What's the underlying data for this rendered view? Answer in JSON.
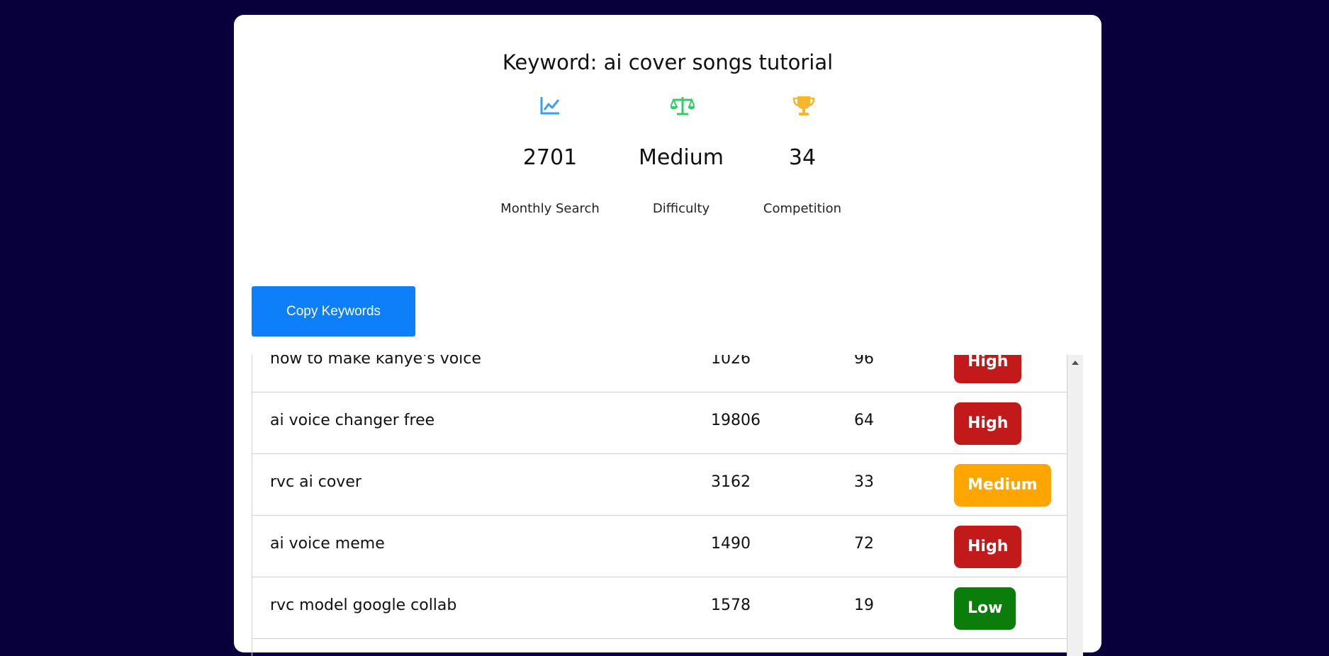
{
  "header": {
    "title": "Keyword: ai cover songs tutorial"
  },
  "stats": [
    {
      "icon": "chart-line-icon",
      "value": "2701",
      "label": "Monthly Search",
      "color": "#3aa0ee"
    },
    {
      "icon": "balance-scale-icon",
      "value": "Medium",
      "label": "Difficulty",
      "color": "#33cc66"
    },
    {
      "icon": "trophy-icon",
      "value": "34",
      "label": "Competition",
      "color": "#f8b62b"
    }
  ],
  "toolbar": {
    "copy_label": "Copy Keywords"
  },
  "keywords": [
    {
      "keyword": "how to make kanye's voice",
      "volume": "1026",
      "competition": "96",
      "level": "High",
      "color": "#c21a1a"
    },
    {
      "keyword": "ai voice changer free",
      "volume": "19806",
      "competition": "64",
      "level": "High",
      "color": "#c21a1a"
    },
    {
      "keyword": "rvc ai cover",
      "volume": "3162",
      "competition": "33",
      "level": "Medium",
      "color": "#ffa500"
    },
    {
      "keyword": "ai voice meme",
      "volume": "1490",
      "competition": "72",
      "level": "High",
      "color": "#c21a1a"
    },
    {
      "keyword": "rvc model google collab",
      "volume": "1578",
      "competition": "19",
      "level": "Low",
      "color": "#0a7d0a"
    }
  ]
}
